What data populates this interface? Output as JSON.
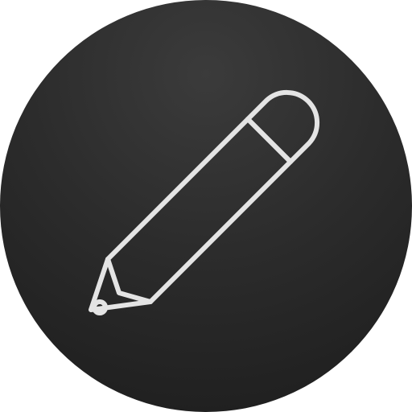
{
  "app_icon": {
    "icon": "pencil-icon",
    "colors": {
      "background_center": "#3b3b3b",
      "background_edge": "#1c1c1c",
      "stroke": "#e4e4e4"
    }
  }
}
